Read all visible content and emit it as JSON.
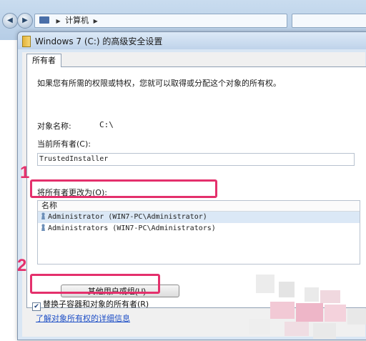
{
  "explorer": {
    "breadcrumb": [
      "计算机"
    ]
  },
  "dialog": {
    "title": "Windows 7 (C:) 的高级安全设置",
    "tab_owner": "所有者",
    "intro": "如果您有所需的权限或特权，您就可以取得或分配这个对象的所有权。",
    "object_name_label": "对象名称:",
    "object_name_value": "C:\\",
    "current_owner_label": "当前所有者(C):",
    "current_owner_value": "TrustedInstaller",
    "change_owner_label": "将所有者更改为(O):",
    "list_header": "名称",
    "owners": [
      {
        "name": "Administrator (WIN7-PC\\Administrator)",
        "selected": true
      },
      {
        "name": "Administrators (WIN7-PC\\Administrators)",
        "selected": false
      }
    ],
    "other_users_button": "其他用户或组(U)...",
    "replace_checkbox_label": "替换子容器和对象的所有者(R)",
    "replace_checked": true,
    "learn_more_link": "了解对象所有权的详细信息"
  },
  "annotations": {
    "step1": "1",
    "step2": "2",
    "color": "#e4306c"
  },
  "icons": {
    "nav_back": "arrow-left-icon",
    "nav_forward": "arrow-right-icon",
    "folder": "folder-icon",
    "user": "user-icon"
  }
}
